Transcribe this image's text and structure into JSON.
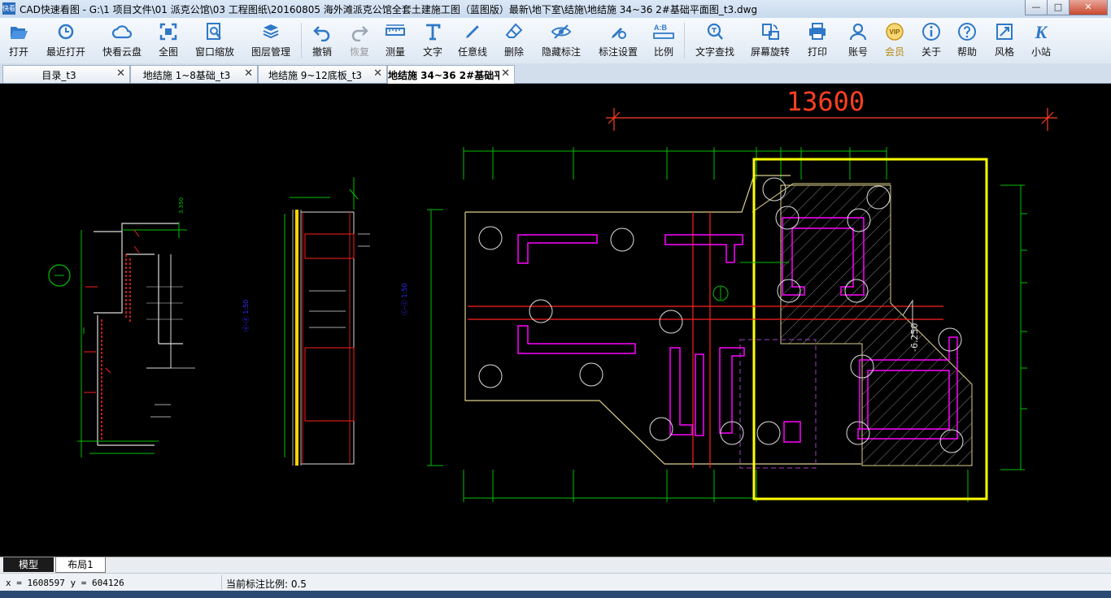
{
  "titlebar": {
    "app_icon": "快看",
    "title": "CAD快速看图 - G:\\1  项目文件\\01  派克公馆\\03  工程图纸\\20160805 海外滩派克公馆全套土建施工图（蓝图版）最新\\地下室\\结施\\地结施 34~36 2#基础平面图_t3.dwg",
    "minimize": "—",
    "maximize": "□",
    "close": "✕"
  },
  "toolbar": {
    "items": [
      {
        "label": "打开",
        "icon": "folder-open-icon"
      },
      {
        "label": "最近打开",
        "icon": "recent-clock-icon"
      },
      {
        "label": "快看云盘",
        "icon": "cloud-icon"
      },
      {
        "label": "全图",
        "icon": "fit-extents-icon"
      },
      {
        "label": "窗口缩放",
        "icon": "zoom-window-icon"
      },
      {
        "label": "图层管理",
        "icon": "layers-icon"
      },
      {
        "label": "撤销",
        "icon": "undo-icon"
      },
      {
        "label": "恢复",
        "icon": "redo-icon"
      },
      {
        "label": "测量",
        "icon": "ruler-icon"
      },
      {
        "label": "文字",
        "icon": "text-icon"
      },
      {
        "label": "任意线",
        "icon": "pen-icon"
      },
      {
        "label": "删除",
        "icon": "eraser-icon"
      },
      {
        "label": "隐藏标注",
        "icon": "eye-hidden-icon"
      },
      {
        "label": "标注设置",
        "icon": "annotation-settings-icon"
      },
      {
        "label": "比例",
        "icon": "scale-ratio-icon"
      },
      {
        "label": "文字查找",
        "icon": "text-search-icon"
      },
      {
        "label": "屏幕旋转",
        "icon": "rotate-screen-icon"
      },
      {
        "label": "打印",
        "icon": "printer-icon"
      },
      {
        "label": "账号",
        "icon": "account-icon"
      },
      {
        "label": "会员",
        "icon": "vip-icon"
      },
      {
        "label": "关于",
        "icon": "info-icon"
      },
      {
        "label": "帮助",
        "icon": "help-icon"
      },
      {
        "label": "风格",
        "icon": "style-icon"
      },
      {
        "label": "小站",
        "icon": "site-k-icon"
      }
    ],
    "vip_badge": "VIP",
    "site_glyph": "K",
    "ratio_glyph": "A:B"
  },
  "tabs": [
    {
      "label": "目录_t3",
      "close": "✕"
    },
    {
      "label": "地结施 1~8基础_t3",
      "close": "✕"
    },
    {
      "label": "地结施 9~12底板_t3",
      "close": "✕"
    },
    {
      "label": "地结施 34~36 2#基础平",
      "close": "✕"
    }
  ],
  "drawing": {
    "big_dimension": "13600",
    "elevation_label": "-6.250"
  },
  "layout_tabs": [
    {
      "label": "模型"
    },
    {
      "label": "布局1"
    }
  ],
  "status": {
    "coords": "x = 1608597  y = 604126",
    "scale": "当前标注比例: 0.5"
  },
  "colors": {
    "canvas_bg": "#000000",
    "cad_yellow": "#ffff00",
    "cad_green": "#00c000",
    "cad_red": "#ff2020",
    "cad_magenta": "#ff00ff",
    "cad_blue": "#3030ff"
  }
}
